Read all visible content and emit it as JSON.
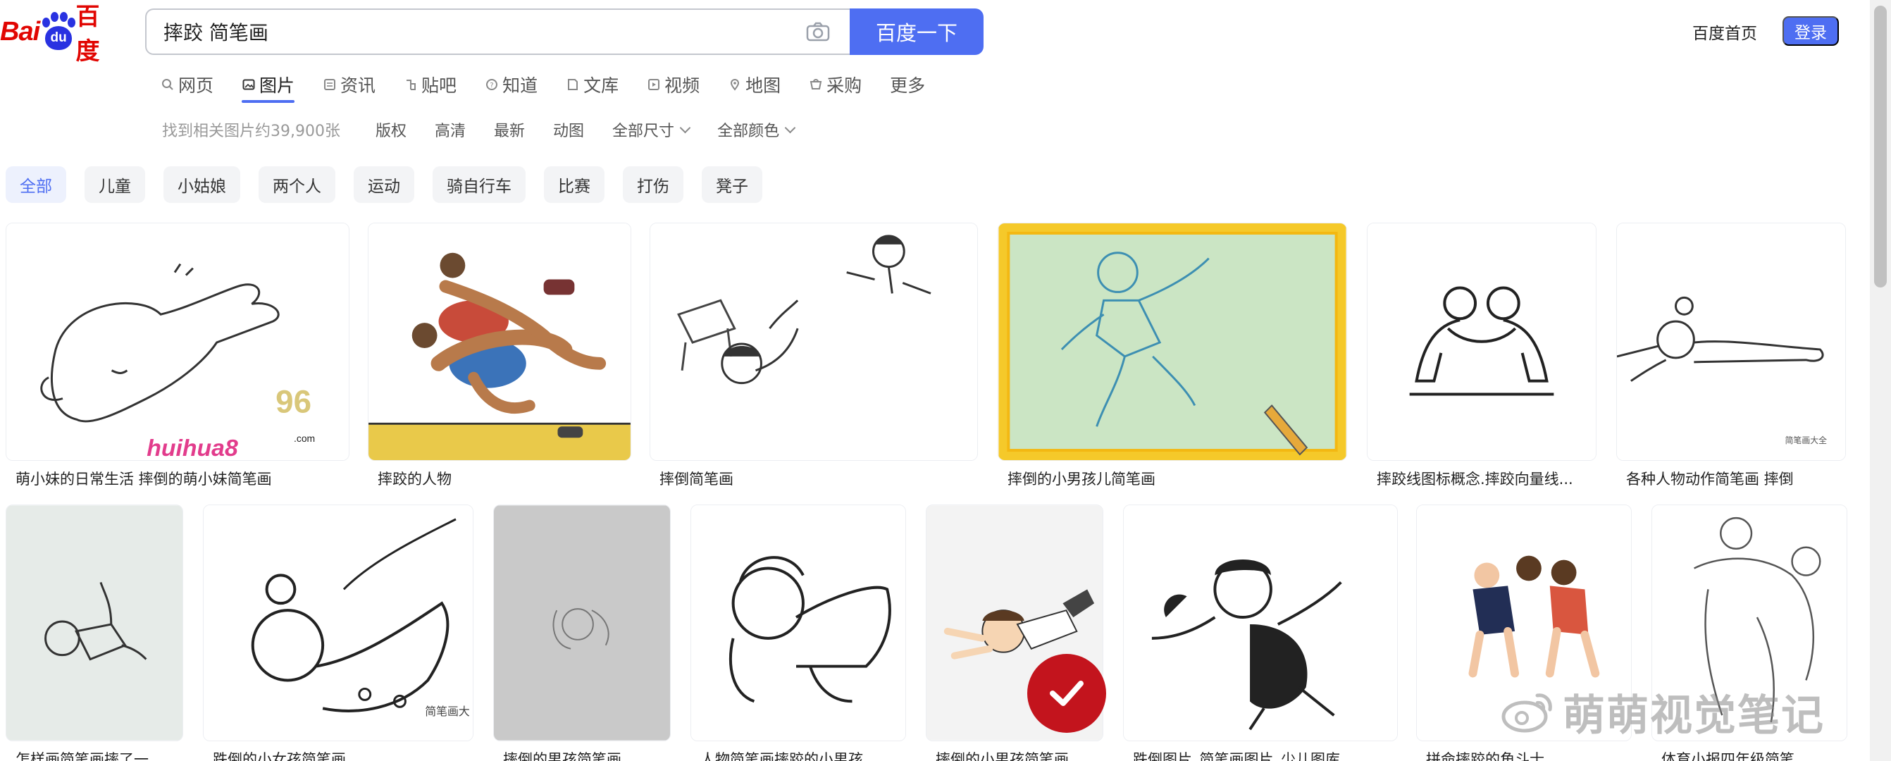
{
  "logo": {
    "bai": "Bai",
    "du": "du",
    "text": "百度"
  },
  "search": {
    "query": "摔跤 简笔画",
    "button_label": "百度一下"
  },
  "header": {
    "home_link": "百度首页",
    "login_label": "登录"
  },
  "tabs": [
    {
      "label": "网页",
      "icon": "search-icon"
    },
    {
      "label": "图片",
      "icon": "image-icon",
      "active": true
    },
    {
      "label": "资讯",
      "icon": "news-icon"
    },
    {
      "label": "贴吧",
      "icon": "tieba-icon"
    },
    {
      "label": "知道",
      "icon": "question-icon"
    },
    {
      "label": "文库",
      "icon": "doc-icon"
    },
    {
      "label": "视频",
      "icon": "video-icon"
    },
    {
      "label": "地图",
      "icon": "map-icon"
    },
    {
      "label": "采购",
      "icon": "cart-icon"
    },
    {
      "label": "更多",
      "icon": ""
    }
  ],
  "filters": {
    "result_count": "找到相关图片约39,900张",
    "items": [
      "版权",
      "高清",
      "最新",
      "动图"
    ],
    "size_label": "全部尺寸",
    "color_label": "全部颜色"
  },
  "chips": [
    "全部",
    "儿童",
    "小姑娘",
    "两个人",
    "运动",
    "骑自行车",
    "比赛",
    "打伤",
    "凳子"
  ],
  "images_row1": [
    {
      "caption": "萌小妹的日常生活 摔倒的萌小妹简笔画",
      "wm_brand": "huihua8",
      "wm_number": "96",
      "wm_com": ".com"
    },
    {
      "caption": "摔跤的人物"
    },
    {
      "caption": "摔倒简笔画"
    },
    {
      "caption": "摔倒的小男孩儿简笔画"
    },
    {
      "caption": "摔跤线图标概念.摔跤向量线..."
    },
    {
      "caption": "各种人物动作简笔画 摔倒",
      "wm_text": "简笔画大全"
    }
  ],
  "images_row2": [
    {
      "caption": "怎样画简笔画摔了一..."
    },
    {
      "caption": "跌倒的小女孩简笔画",
      "wm_text": "简笔画大"
    },
    {
      "caption": "摔倒的男孩简笔画"
    },
    {
      "caption": "人物简笔画摔跤的小男孩..."
    },
    {
      "caption": "摔倒的小男孩简笔画"
    },
    {
      "caption": "跌倒图片_简笔画图片_少儿图库"
    },
    {
      "caption": "拼命摔跤的角斗士"
    },
    {
      "caption": "体育小报四年级简笔..."
    }
  ],
  "watermark": {
    "text": "萌萌视觉笔记"
  },
  "colors": {
    "accent": "#4e6ef2",
    "brand_red": "#e10602",
    "brand_blue": "#2932e1",
    "chip_bg": "#f3f4f6",
    "check_red": "#c3141d"
  }
}
